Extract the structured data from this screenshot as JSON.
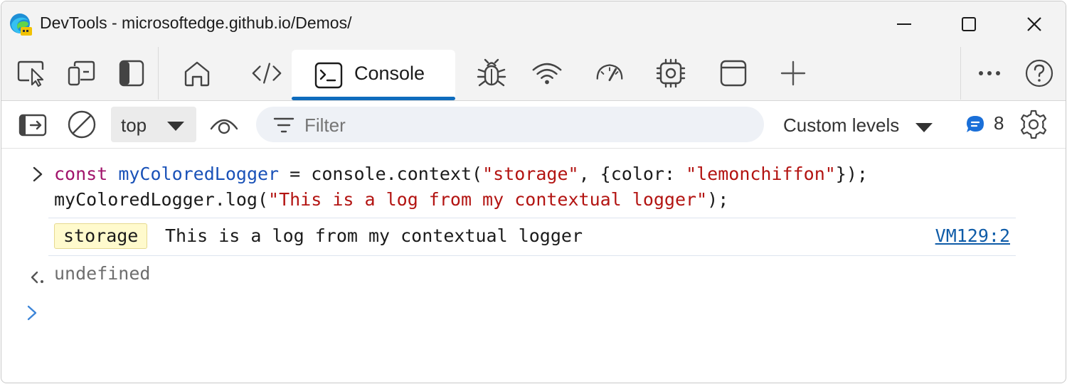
{
  "window": {
    "title": "DevTools - microsoftedge.github.io/Demos/"
  },
  "tabs": {
    "active_label": "Console",
    "items": [
      "Inspect",
      "Device emulation",
      "Dock side",
      "Welcome",
      "Elements",
      "Console",
      "Sources",
      "Network",
      "Performance",
      "Memory",
      "Application",
      "More tools"
    ]
  },
  "toolbar": {
    "context_value": "top",
    "filter_placeholder": "Filter",
    "levels_label": "Custom levels",
    "issues_count": "8"
  },
  "console": {
    "input_line1": {
      "kw": "const",
      "var": "myColoredLogger",
      "mid": " = console.context(",
      "str1": "\"storage\"",
      "mid2": ", {color: ",
      "str2": "\"lemonchiffon\"",
      "end": "});"
    },
    "input_line2": {
      "pre": "myColoredLogger.log(",
      "str": "\"This is a log from my contextual logger\"",
      "end": ");"
    },
    "log_context": "storage",
    "log_message": "This is a log from my contextual logger",
    "log_source": "VM129:2",
    "result": "undefined"
  },
  "colors": {
    "accent": "#0f6cbd",
    "context_badge": "#fffacd",
    "keyword": "#a1136b",
    "string": "#b31412",
    "variable": "#1a52b8"
  }
}
